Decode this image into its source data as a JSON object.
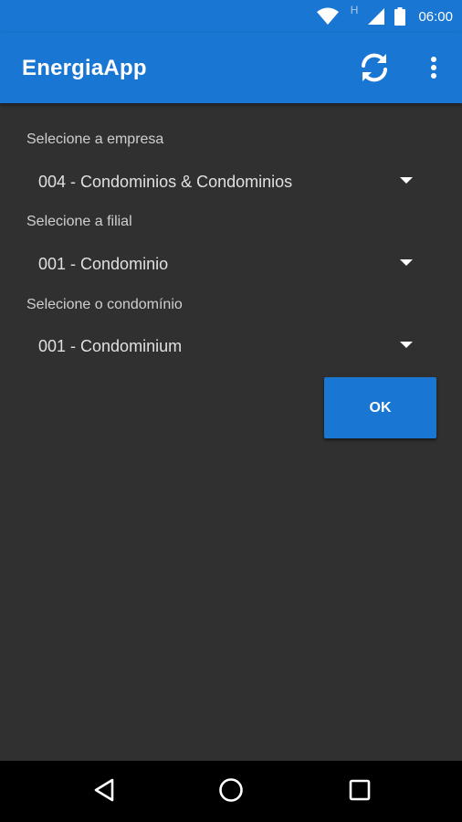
{
  "status_bar": {
    "time": "06:00",
    "network_label": "H",
    "icons": [
      "wifi-icon",
      "signal-icon",
      "battery-icon"
    ]
  },
  "app_bar": {
    "title": "EnergiaApp",
    "actions": [
      "refresh-icon",
      "overflow-menu-icon"
    ]
  },
  "form": {
    "empresa": {
      "label": "Selecione a empresa",
      "value": "004 - Condominios & Condominios"
    },
    "filial": {
      "label": "Selecione a filial",
      "value": "001 - Condominio"
    },
    "condominio": {
      "label": "Selecione o condomínio",
      "value": "001 - Condominium"
    },
    "ok_label": "OK"
  },
  "nav_bar": {
    "buttons": [
      "back-icon",
      "home-icon",
      "recents-icon"
    ]
  },
  "colors": {
    "primary": "#1976d2",
    "background": "#303030",
    "nav_bar": "#000000"
  }
}
